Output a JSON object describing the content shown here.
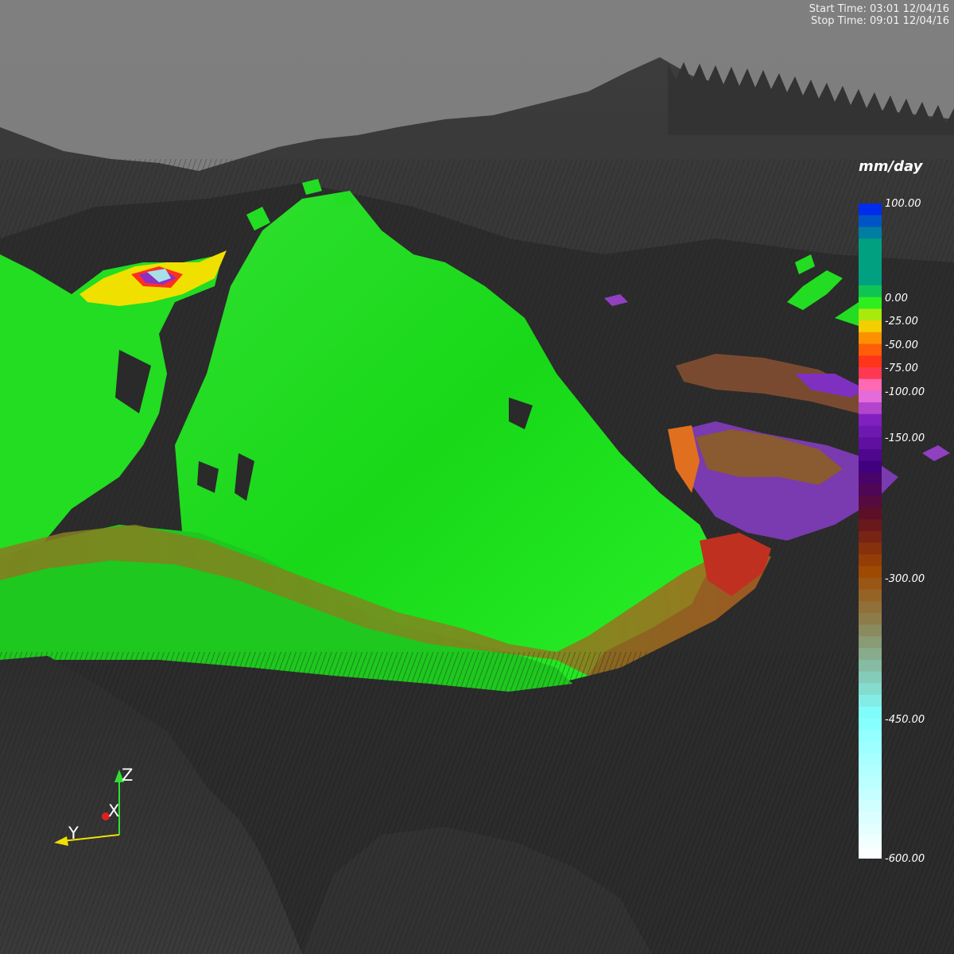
{
  "time_info": {
    "start": "Start Time: 03:01 12/04/16",
    "stop": "Stop Time: 09:01 12/04/16"
  },
  "legend": {
    "title": "mm/day",
    "ticks": [
      {
        "label": "100.00",
        "value": 100
      },
      {
        "label": "0.00",
        "value": 0
      },
      {
        "label": "-25.00",
        "value": -25
      },
      {
        "label": "-50.00",
        "value": -50
      },
      {
        "label": "-75.00",
        "value": -75
      },
      {
        "label": "-100.00",
        "value": -100
      },
      {
        "label": "-150.00",
        "value": -150
      },
      {
        "label": "-300.00",
        "value": -300
      },
      {
        "label": "-450.00",
        "value": -450
      },
      {
        "label": "-600.00",
        "value": -600
      }
    ],
    "colors": {
      "blue": "#0018ff",
      "teal": "#00a080",
      "green": "#22ee22",
      "yellow": "#f0e800",
      "orange": "#ff7000",
      "red": "#ff2020",
      "pink": "#ff80e0",
      "purple": "#8020c0",
      "indigo": "#400080",
      "maroon": "#601020",
      "brown": "#a04800",
      "olive": "#8a8050",
      "cyan": "#80ffff",
      "white": "#ffffff"
    }
  },
  "axes": {
    "x": "X",
    "y": "Y",
    "z": "Z"
  }
}
